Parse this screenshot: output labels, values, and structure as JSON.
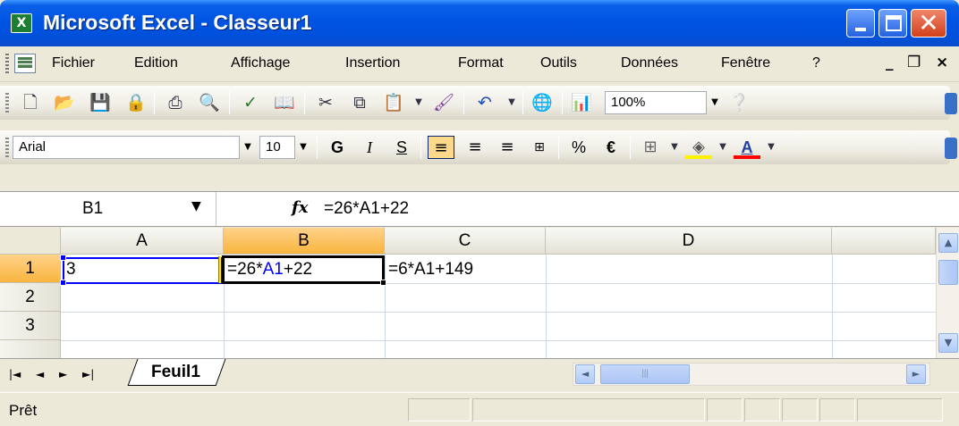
{
  "window": {
    "title": "Microsoft Excel - Classeur1",
    "app_icon_glyph": "X",
    "minimize_icon": "minimize-icon",
    "maximize_icon": "maximize-icon",
    "close_glyph": "✕"
  },
  "menu": {
    "items": [
      "Fichier",
      "Edition",
      "Affichage",
      "Insertion",
      "Format",
      "Outils",
      "Données",
      "Fenêtre",
      "?"
    ],
    "doc_min": "_",
    "doc_restore": "❐",
    "doc_close": "×"
  },
  "toolbar_standard": {
    "icons": [
      "new-icon",
      "open-icon",
      "save-icon",
      "permission-icon",
      "print-icon",
      "print-preview-icon",
      "spelling-icon",
      "research-icon",
      "cut-icon",
      "copy-icon",
      "paste-icon",
      "format-painter-icon",
      "undo-icon",
      "hyperlink-icon",
      "chart-wizard-icon",
      "help-icon"
    ],
    "zoom": "100%"
  },
  "toolbar_formatting": {
    "font": "Arial",
    "size": "10",
    "bold": "G",
    "italic": "I",
    "underline": "S",
    "percent": "%",
    "euro": "€",
    "font_color_letter": "A"
  },
  "formula_bar": {
    "name_box": "B1",
    "fx": "fx",
    "formula": "=26*A1+22"
  },
  "grid": {
    "columns": [
      "A",
      "B",
      "C",
      "D"
    ],
    "rows": [
      "1",
      "2",
      "3"
    ],
    "cells": {
      "A1": "3",
      "B1_prefix": "=26*",
      "B1_ref": "A1",
      "B1_suffix": "+22",
      "C1": "=6*A1+149"
    }
  },
  "sheet_tabs": {
    "nav": [
      "|◄",
      "◄",
      "►",
      "►|"
    ],
    "tabs": [
      "Feuil1"
    ]
  },
  "status": {
    "text": "Prêt"
  }
}
